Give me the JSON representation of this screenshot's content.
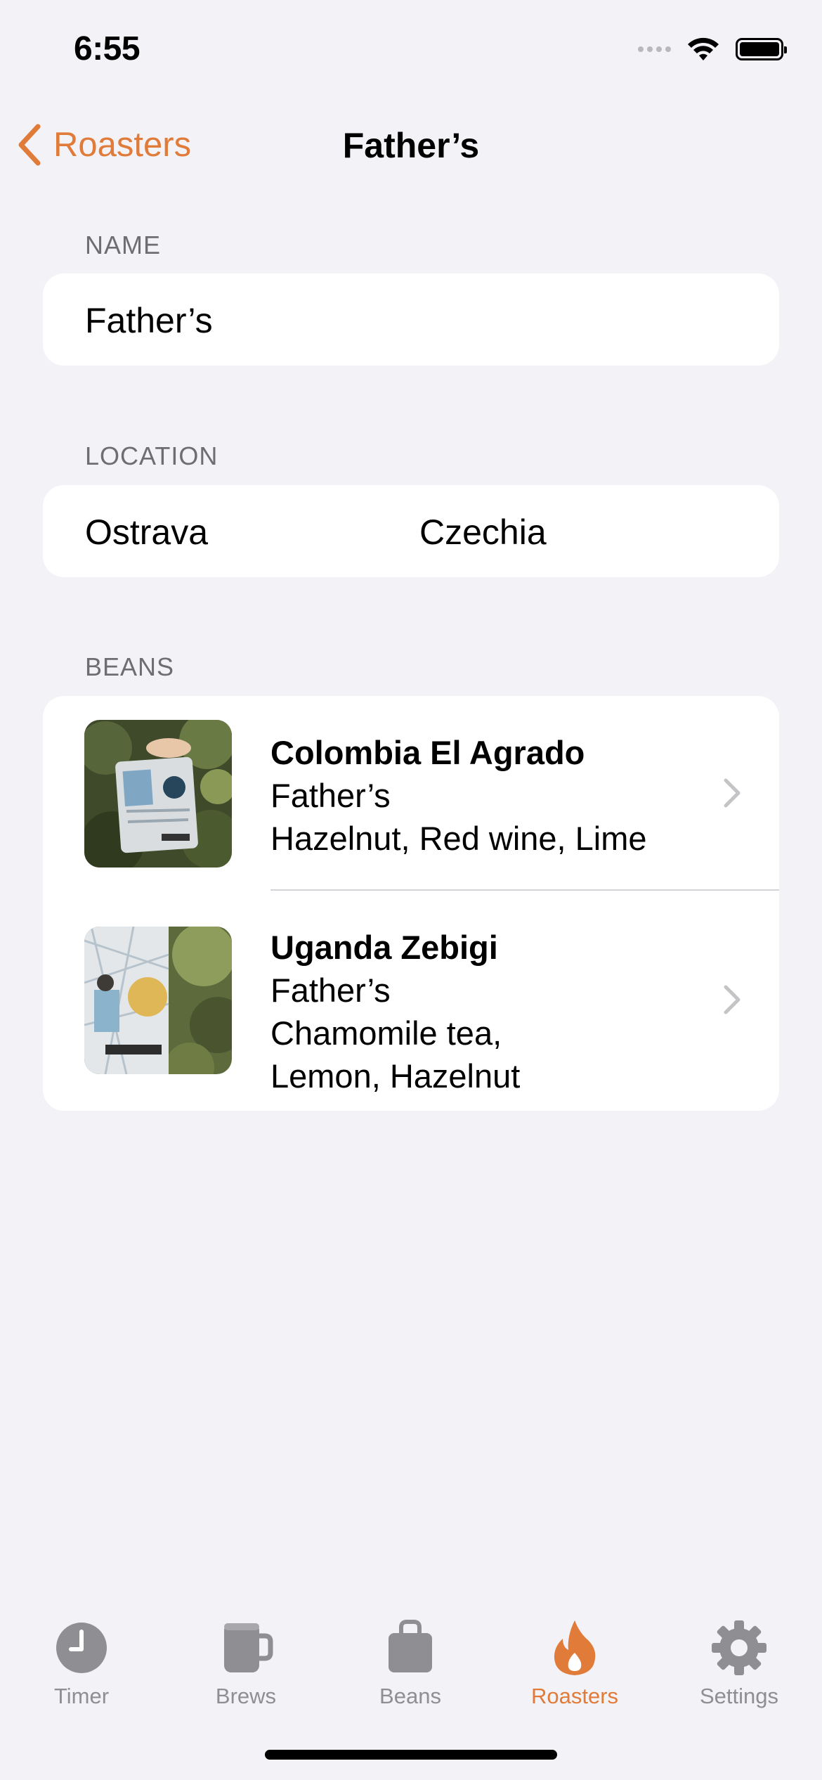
{
  "status_bar": {
    "time": "6:55"
  },
  "nav": {
    "back_label": "Roasters",
    "title": "Father’s"
  },
  "sections": {
    "name": {
      "header": "NAME",
      "value": "Father’s"
    },
    "location": {
      "header": "LOCATION",
      "city": "Ostrava",
      "country": "Czechia"
    },
    "beans": {
      "header": "BEANS",
      "items": [
        {
          "name": "Colombia El Agrado",
          "roaster": "Father’s",
          "notes_line1": "Hazelnut, Red wine, Lime",
          "notes_line2": ""
        },
        {
          "name": "Uganda Zebigi",
          "roaster": "Father’s",
          "notes_line1": "Chamomile tea,",
          "notes_line2": "Lemon, Hazelnut"
        }
      ]
    }
  },
  "tabs": [
    {
      "label": "Timer",
      "icon": "clock-icon"
    },
    {
      "label": "Brews",
      "icon": "mug-icon"
    },
    {
      "label": "Beans",
      "icon": "bag-icon"
    },
    {
      "label": "Roasters",
      "icon": "flame-icon",
      "active": true
    },
    {
      "label": "Settings",
      "icon": "gear-icon"
    }
  ],
  "colors": {
    "accent": "#e07b39",
    "background": "#f2f2f7",
    "inactive_tab": "#8e8e93"
  }
}
